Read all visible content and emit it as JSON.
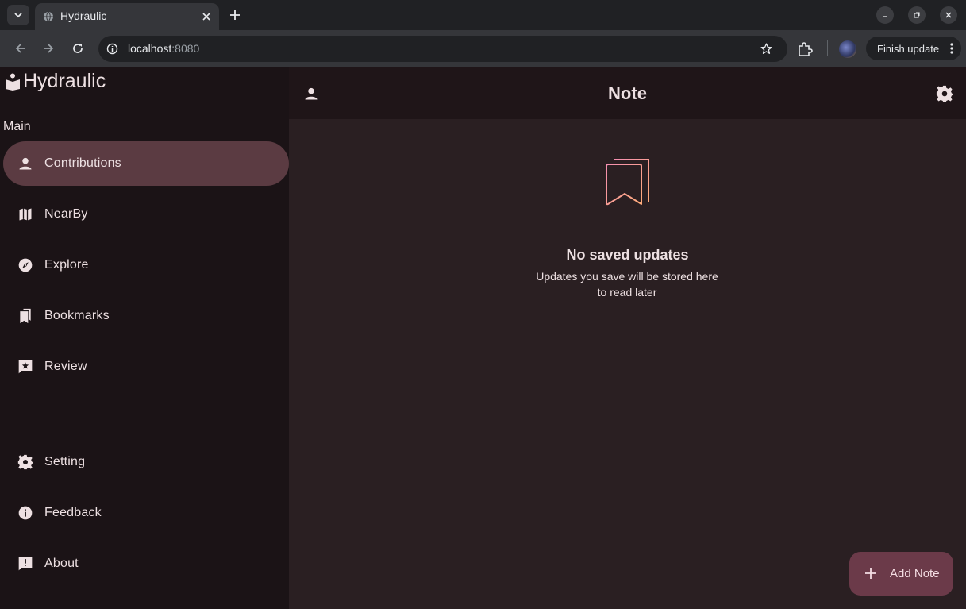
{
  "browser": {
    "tab_title": "Hydraulic",
    "url_host": "localhost",
    "url_port": ":8080",
    "finish_update_label": "Finish update"
  },
  "app": {
    "brand": "Hydraulic",
    "section_label": "Main",
    "nav_main": [
      {
        "label": "Contributions",
        "icon": "person-icon",
        "active": true
      },
      {
        "label": "NearBy",
        "icon": "map-icon",
        "active": false
      },
      {
        "label": "Explore",
        "icon": "compass-icon",
        "active": false
      },
      {
        "label": "Bookmarks",
        "icon": "bookmarks-icon",
        "active": false
      },
      {
        "label": "Review",
        "icon": "rate-review-icon",
        "active": false
      }
    ],
    "nav_secondary": [
      {
        "label": "Setting",
        "icon": "gear-icon"
      },
      {
        "label": "Feedback",
        "icon": "info-icon"
      },
      {
        "label": "About",
        "icon": "feedback-icon"
      }
    ],
    "page_title": "Note",
    "empty_state": {
      "title": "No saved updates",
      "subtitle_line1": "Updates you save will be stored here",
      "subtitle_line2": "to read later"
    },
    "fab_label": "Add Note",
    "colors": {
      "accent": "#5b3b42",
      "fab": "#6b3a49",
      "empty_icon_gradient": [
        "#f48fb1",
        "#ffab7a"
      ]
    }
  }
}
